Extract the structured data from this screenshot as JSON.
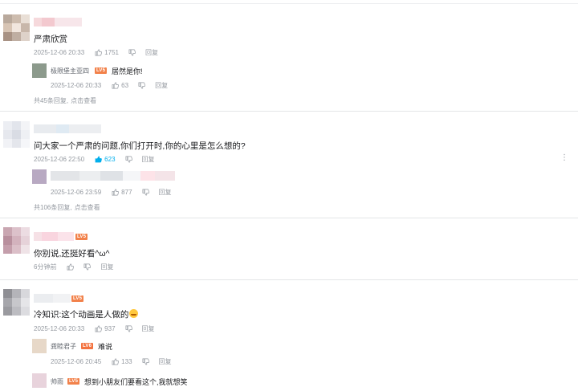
{
  "level_badge": "LV5",
  "level_badge_alt": "LV6",
  "icons": {
    "like": "thumbs-up-icon",
    "dislike": "thumbs-down-icon",
    "more": "more-vertical-icon",
    "emoji": "laughing-emoji-icon"
  },
  "colors": {
    "meta": "#9499a0",
    "like_active": "#00aeec",
    "badge": "#f2814a",
    "divider": "#e3e5e7"
  },
  "comments": [
    {
      "text": "严肃欣赏",
      "date": "2025-12-06 20:33",
      "likes": "1751",
      "reply_label": "回复",
      "sub_replies": [
        {
          "name": "极限堡主亚四",
          "text": "居然是你!",
          "date": "2025-12-06 20:33",
          "likes": "63",
          "reply_label": "回复"
        }
      ],
      "summary": "共45条回复,",
      "summary_link": "点击查看"
    },
    {
      "text": "问大家一个严肃的问题,你们打开时,你的心里是怎么想的?",
      "date": "2025-12-06 22:50",
      "likes": "623",
      "reply_label": "回复",
      "more": "⋮",
      "sub_replies": [
        {
          "name": "",
          "text": "",
          "date": "2025-12-06 23:59",
          "likes": "877",
          "reply_label": "回复"
        }
      ],
      "summary": "共106条回复,",
      "summary_link": "点击查看"
    },
    {
      "text": "你别说,还挺好看^ω^",
      "date": "6分钟前",
      "likes": "",
      "reply_label": "回复"
    },
    {
      "text": "冷知识:这个动画是人做的",
      "date": "2025-12-06 20:33",
      "likes": "937",
      "reply_label": "回复",
      "sub_replies": [
        {
          "name": "龚睦君子",
          "text": "难说",
          "date": "2025-12-06 20:45",
          "likes": "133",
          "reply_label": "回复"
        },
        {
          "name": "帅雨",
          "text": "想到小朋友们要看这个,我就想笑"
        }
      ]
    }
  ]
}
